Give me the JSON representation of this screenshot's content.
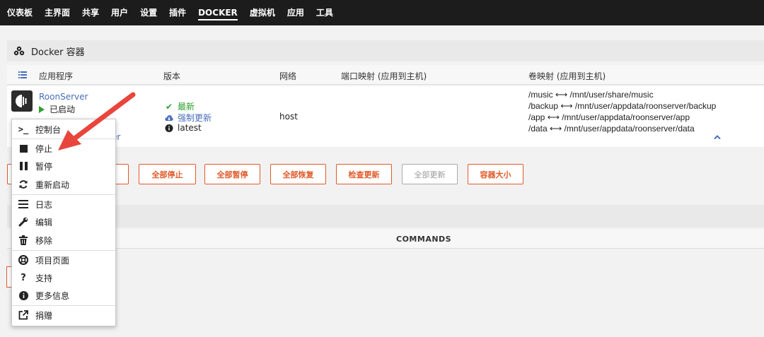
{
  "nav": {
    "items": [
      "仪表板",
      "主界面",
      "共享",
      "用户",
      "设置",
      "插件",
      "DOCKER",
      "虚拟机",
      "应用",
      "工具"
    ],
    "active": "DOCKER"
  },
  "section": {
    "title": "Docker 容器"
  },
  "table": {
    "headers": {
      "app": "应用程序",
      "version": "版本",
      "network": "网络",
      "ports": "端口映射 (应用到主机)",
      "volumes": "卷映射 (应用到主机)"
    }
  },
  "container": {
    "name": "RoonServer",
    "status": "已启动",
    "name_partial": "er",
    "version_latest": "最新",
    "version_force": "强制更新",
    "version_tag": "latest",
    "network": "host",
    "volumes": [
      "/music ⟷ /mnt/user/share/music",
      "/backup ⟷ /mnt/user/appdata/roonserver/backup",
      "/app ⟷ /mnt/user/appdata/roonserver/app",
      "/data ⟷ /mnt/user/appdata/roonserver/data"
    ]
  },
  "buttons": {
    "stop_all": "全部停止",
    "pause_all": "全部暂停",
    "resume_all": "全部恢复",
    "check_updates": "检查更新",
    "update_all": "全部更新",
    "container_size": "容器大小"
  },
  "commands_header": "COMMANDS",
  "menu": {
    "console": "控制台",
    "stop": "停止",
    "pause": "暂停",
    "restart": "重新启动",
    "log": "日志",
    "edit": "编辑",
    "remove": "移除",
    "project_page": "项目页面",
    "support": "支持",
    "more_info": "更多信息",
    "donate": "捐赠"
  },
  "colors": {
    "accent": "#e05a2a",
    "link": "#486dba",
    "ok": "#2ea02e",
    "arrow": "#e8453c"
  }
}
